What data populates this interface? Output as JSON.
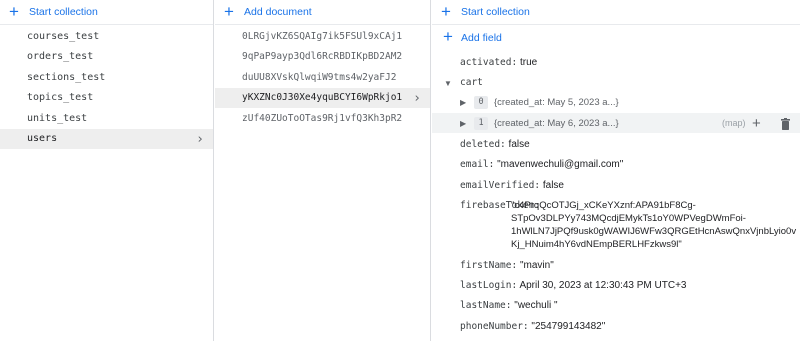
{
  "collections": {
    "start_label": "Start collection",
    "items": [
      {
        "label": "courses_test",
        "selected": false
      },
      {
        "label": "orders_test",
        "selected": false
      },
      {
        "label": "sections_test",
        "selected": false
      },
      {
        "label": "topics_test",
        "selected": false
      },
      {
        "label": "units_test",
        "selected": false
      },
      {
        "label": "users",
        "selected": true
      }
    ]
  },
  "documents": {
    "add_label": "Add document",
    "items": [
      {
        "id": "0LRGjvKZ6SQAIg7ik5FSUl9xCAj1",
        "selected": false
      },
      {
        "id": "9qPaP9ayp3Qdl6RcRBDIKpBD2AM2",
        "selected": false
      },
      {
        "id": "duUU8XVskQlwqiW9tms4w2yaFJ2",
        "selected": false
      },
      {
        "id": "yKXZNc0J30Xe4yquBCYI6WpRkjo1",
        "selected": true
      },
      {
        "id": "zUf40ZUoToOTas9Rj1vfQ3Kh3pR2",
        "selected": false
      }
    ]
  },
  "fields_panel": {
    "start_label": "Start collection",
    "add_field_label": "Add field",
    "activated": {
      "key": "activated:",
      "value": "true"
    },
    "cart": {
      "key": "cart",
      "entries": [
        {
          "index": "0",
          "summary": "{created_at: May 5, 2023 a...}"
        },
        {
          "index": "1",
          "summary": "{created_at: May 6, 2023 a...}",
          "type": "(map)"
        }
      ]
    },
    "deleted": {
      "key": "deleted:",
      "value": "false"
    },
    "email": {
      "key": "email:",
      "value": "\"mavenwechuli@gmail.com\""
    },
    "emailVerified": {
      "key": "emailVerified:",
      "value": "false"
    },
    "firebaseToken": {
      "key": "firebaseToken:",
      "lines": [
        "\"c4PrqQcOTJGj_xCKeYXznf:APA91bF8Cg-",
        "STpOv3DLPYy743MQcdjEMykTs1oY0WPVegDWmFoi-",
        "1hWlLN7JjPQf9usk0gWAWIJ6WFw3QRGEtHcnAswQnxVjnbLyio0v",
        "Kj_HNuim4hY6vdNEmpBERLHFzkws9l\""
      ]
    },
    "firstName": {
      "key": "firstName:",
      "value": "\"mavin\""
    },
    "lastLogin": {
      "key": "lastLogin:",
      "value": "April 30, 2023 at 12:30:43 PM UTC+3"
    },
    "lastName": {
      "key": "lastName:",
      "value": "\"wechuli \""
    },
    "phoneNumber": {
      "key": "phoneNumber:",
      "value": "\"254799143482\""
    }
  },
  "colors": {
    "accent": "#1a73e8",
    "selected_bg": "#eeeeee",
    "border": "#dadce0"
  }
}
